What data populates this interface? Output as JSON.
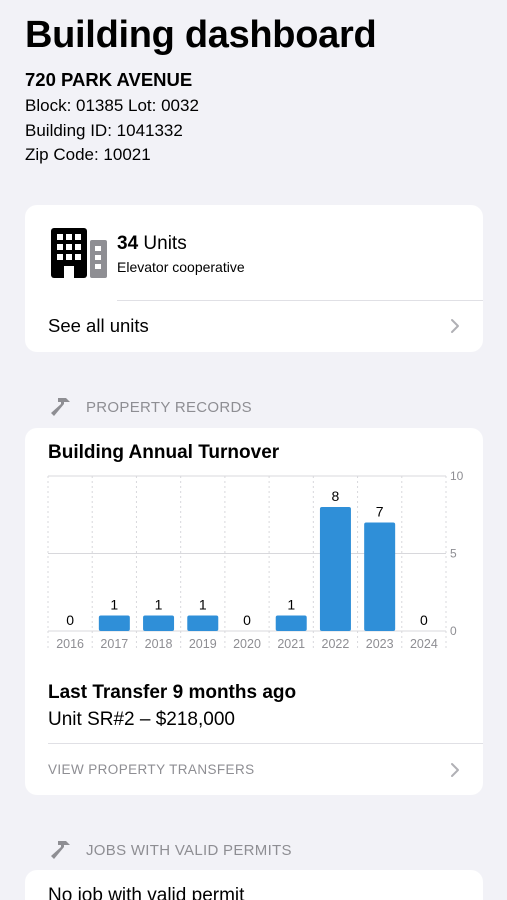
{
  "header": {
    "title": "Building dashboard",
    "address": "720 PARK AVENUE",
    "block_lot": "Block: 01385 Lot: 0032",
    "building_id": "Building ID: 1041332",
    "zip": "Zip Code: 10021"
  },
  "units": {
    "count": "34",
    "count_label": " Units",
    "type": "Elevator cooperative",
    "see_all": "See all units",
    "icon": "building-icon"
  },
  "property_records": {
    "section_label": "PROPERTY RECORDS",
    "icon": "hammer-icon",
    "last_transfer": "Last Transfer 9 months ago",
    "transfer_detail": "Unit SR#2 – $218,000",
    "view_transfers": "VIEW PROPERTY TRANSFERS"
  },
  "chart_data": {
    "type": "bar",
    "title": "Building Annual Turnover",
    "categories": [
      "2016",
      "2017",
      "2018",
      "2019",
      "2020",
      "2021",
      "2022",
      "2023",
      "2024"
    ],
    "values": [
      0,
      1,
      1,
      1,
      0,
      1,
      8,
      7,
      0
    ],
    "ylim": [
      0,
      10
    ],
    "y_ticks": [
      "0",
      "5",
      "10"
    ],
    "y_axis_side": "right",
    "grid": true,
    "bar_color": "#2f8fd8"
  },
  "permits": {
    "section_label": "JOBS WITH VALID PERMITS",
    "icon": "hammer-icon",
    "empty_text": "No job with valid permit"
  },
  "colors": {
    "background": "#f2f2f7",
    "card": "#ffffff",
    "secondary_text": "#8e8e93",
    "accent": "#2f8fd8"
  }
}
